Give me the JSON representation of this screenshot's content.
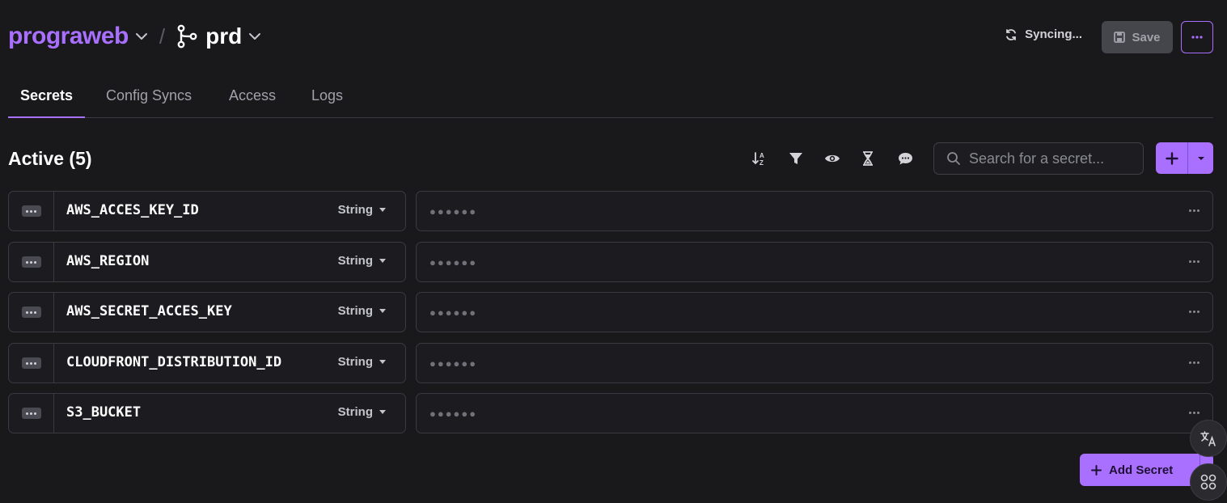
{
  "header": {
    "project_name": "prograweb",
    "separator": "/",
    "branch_name": "prd",
    "status_text": "Syncing...",
    "save_label": "Save"
  },
  "tabs": [
    {
      "label": "Secrets",
      "active": true
    },
    {
      "label": "Config Syncs",
      "active": false
    },
    {
      "label": "Access",
      "active": false
    },
    {
      "label": "Logs",
      "active": false
    }
  ],
  "toolbar": {
    "title": "Active (5)",
    "search_placeholder": "Search for a secret...",
    "icons": [
      "sort-icon",
      "filter-icon",
      "eye-icon",
      "hourglass-icon",
      "comment-icon"
    ]
  },
  "secrets": [
    {
      "name": "AWS_ACCES_KEY_ID",
      "type": "String",
      "value_mask": "●●●●●●"
    },
    {
      "name": "AWS_REGION",
      "type": "String",
      "value_mask": "●●●●●●"
    },
    {
      "name": "AWS_SECRET_ACCES_KEY",
      "type": "String",
      "value_mask": "●●●●●●"
    },
    {
      "name": "CLOUDFRONT_DISTRIBUTION_ID",
      "type": "String",
      "value_mask": "●●●●●●"
    },
    {
      "name": "S3_BUCKET",
      "type": "String",
      "value_mask": "●●●●●●"
    }
  ],
  "footer": {
    "add_secret_label": "Add Secret"
  },
  "colors": {
    "accent": "#a970ff",
    "background": "#19191c",
    "surface": "#1c1c20",
    "border": "#3a3a40"
  }
}
